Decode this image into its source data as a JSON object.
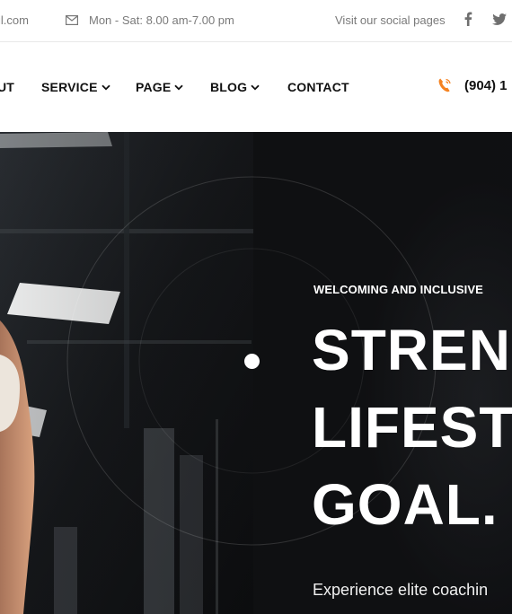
{
  "topbar": {
    "email_fragment": "il.com",
    "hours": "Mon - Sat: 8.00 am-7.00 pm",
    "social_label": "Visit our social pages",
    "icons": [
      "mail-icon",
      "facebook-icon",
      "twitter-icon"
    ]
  },
  "nav": {
    "items": [
      {
        "label": "UT"
      },
      {
        "label": "SERVICE",
        "dropdown": true
      },
      {
        "label": "PAGE",
        "dropdown": true
      },
      {
        "label": "BLOG",
        "dropdown": true
      },
      {
        "label": "CONTACT"
      }
    ],
    "phone": "(904) 1",
    "phone_icon": "phone-icon",
    "accent_color": "#f58220"
  },
  "hero": {
    "eyebrow": "WELCOMING AND INCLUSIVE",
    "headline_lines": [
      "STREN",
      "LIFEST",
      "GOAL."
    ],
    "description": "Experience elite coachin"
  }
}
